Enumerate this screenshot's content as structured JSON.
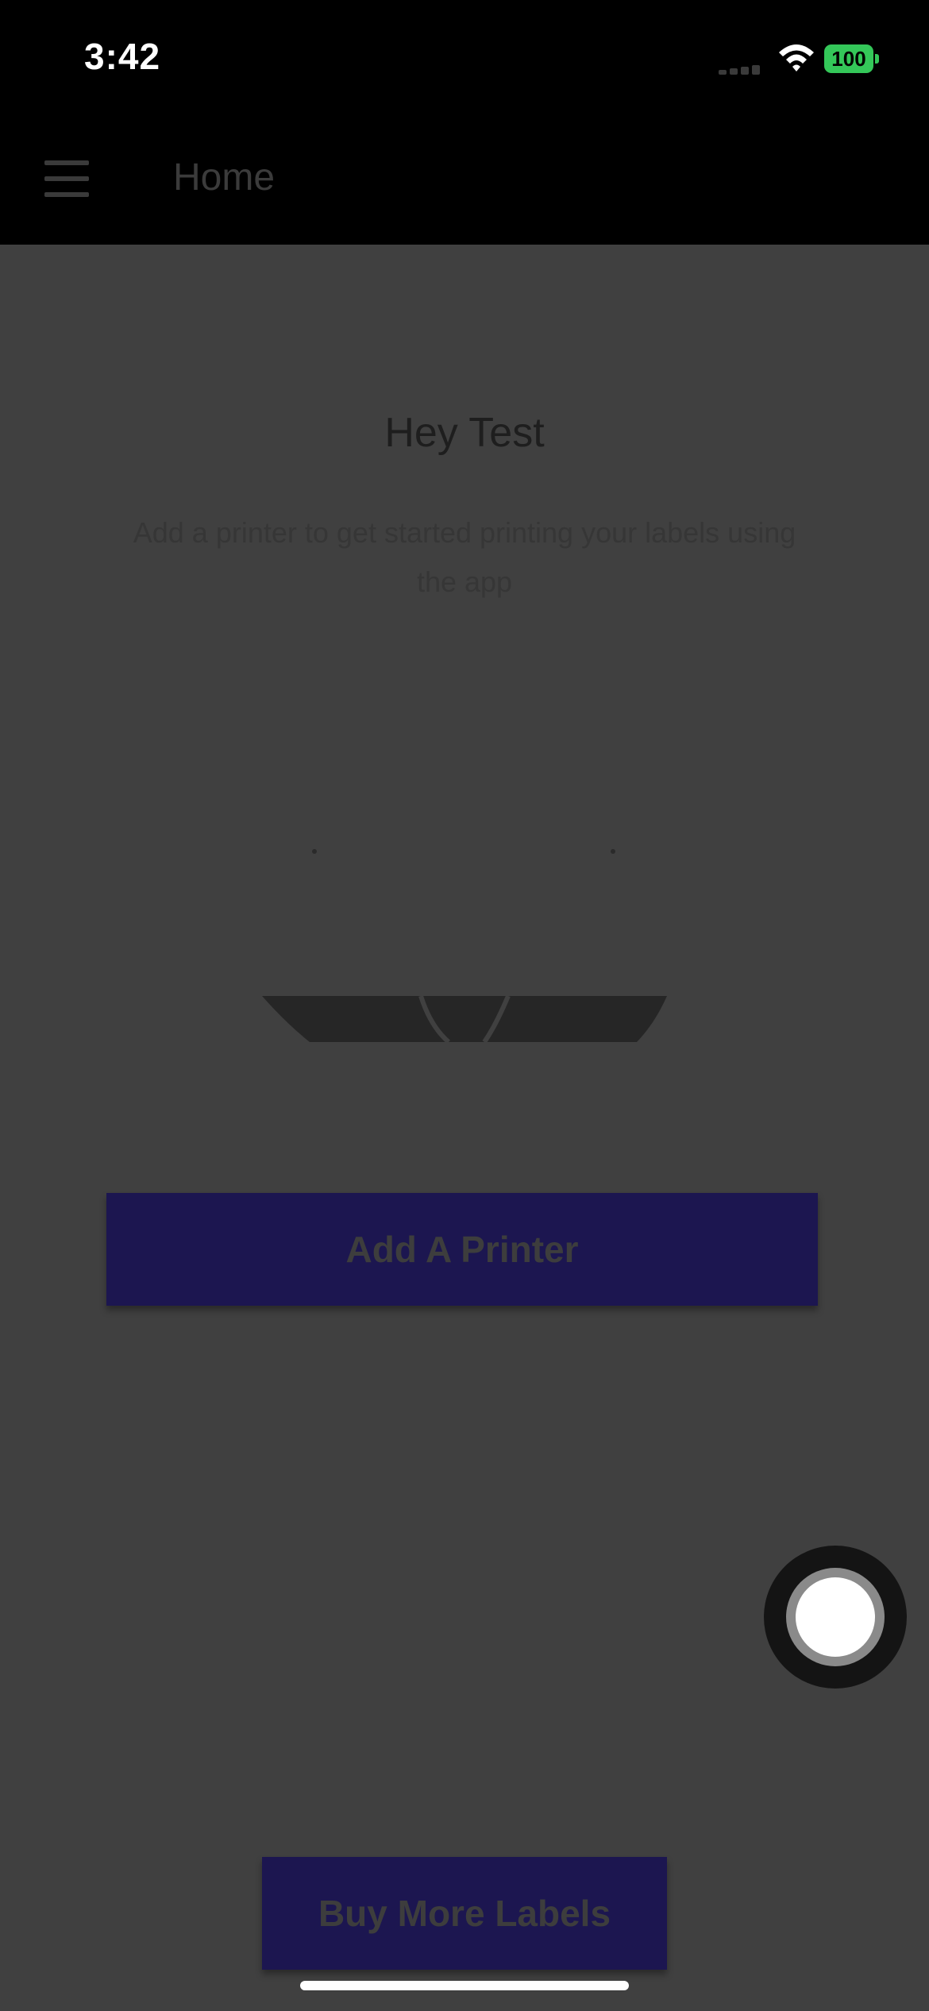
{
  "status_bar": {
    "time": "3:42",
    "battery_level": "100",
    "icons": [
      "signal-icon",
      "wifi-icon",
      "battery-icon"
    ],
    "battery_color": "#34c759"
  },
  "header": {
    "title": "Home",
    "menu_icon": "hamburger-menu-icon",
    "background": "#000000"
  },
  "main": {
    "greeting": "Hey Test",
    "subtitle": "Add a printer to get started printing your labels using the app",
    "illustration": "printer-icon",
    "add_printer_label": "Add A Printer",
    "buy_labels_label": "Buy More Labels",
    "button_color": "#1c1650",
    "overlay_color": "#404040"
  },
  "floating_button": {
    "icon": "assistive-touch-icon"
  }
}
